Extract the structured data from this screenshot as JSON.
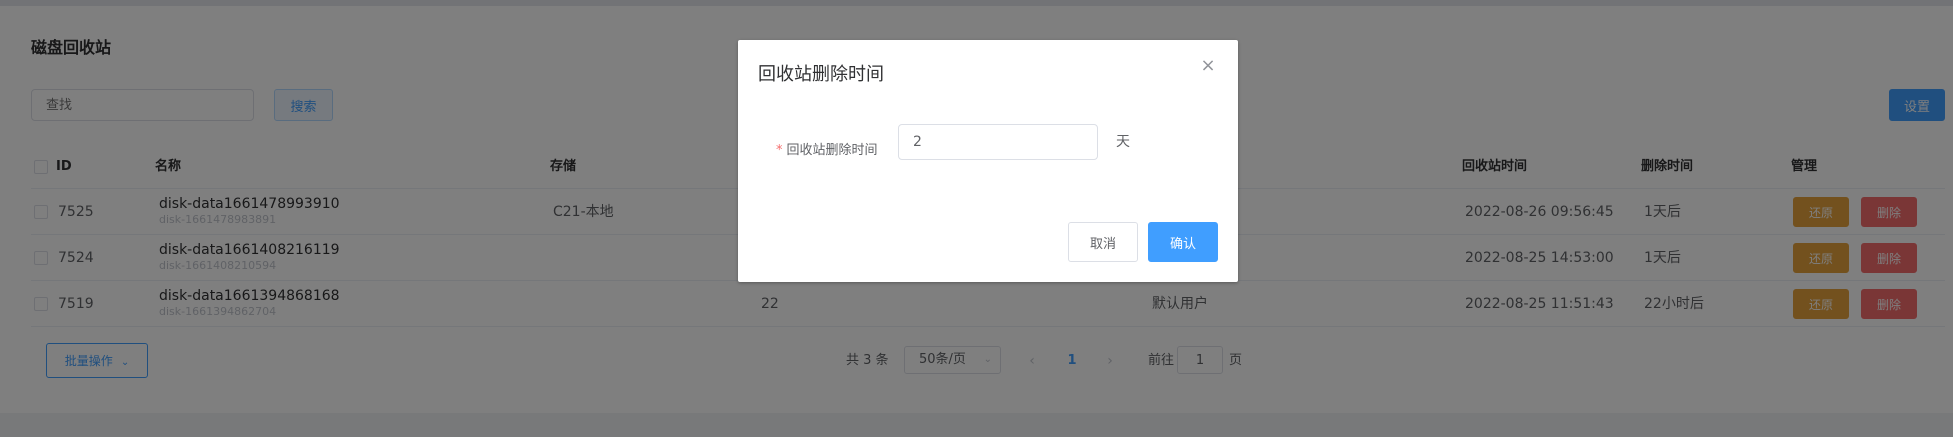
{
  "page": {
    "title": "磁盘回收站"
  },
  "toolbar": {
    "search_placeholder": "查找",
    "search_label": "搜索",
    "settings_label": "设置"
  },
  "table": {
    "columns": {
      "id": "ID",
      "name": "名称",
      "storage": "存储",
      "recycle_time": "回收站时间",
      "delete_time": "删除时间",
      "manage": "管理"
    },
    "rows": [
      {
        "id": "7525",
        "name": "disk-data1661478993910",
        "sub": "disk-1661478983891",
        "storage": "C21-本地",
        "size": "",
        "owner": "",
        "recycle_time": "2022-08-26 09:56:45",
        "delete_time": "1天后"
      },
      {
        "id": "7524",
        "name": "disk-data1661408216119",
        "sub": "disk-1661408210594",
        "storage": "",
        "size": "",
        "owner": "",
        "recycle_time": "2022-08-25 14:53:00",
        "delete_time": "1天后"
      },
      {
        "id": "7519",
        "name": "disk-data1661394868168",
        "sub": "disk-1661394862704",
        "storage": "",
        "size": "22",
        "owner": "默认用户",
        "recycle_time": "2022-08-25 11:51:43",
        "delete_time": "22小时后"
      }
    ],
    "restore_label": "还原",
    "delete_label": "删除"
  },
  "footer": {
    "batch_label": "批量操作",
    "total_text": "共 3 条",
    "page_size": "50条/页",
    "current_page": "1",
    "goto_prefix": "前往",
    "goto_value": "1",
    "goto_suffix": "页"
  },
  "dialog": {
    "title": "回收站删除时间",
    "field_label": "回收站删除时间",
    "field_value": "2",
    "unit": "天",
    "cancel_label": "取消",
    "confirm_label": "确认"
  },
  "colors": {
    "primary": "#409eff",
    "warning": "#e6a23c",
    "danger": "#f56c6c"
  }
}
